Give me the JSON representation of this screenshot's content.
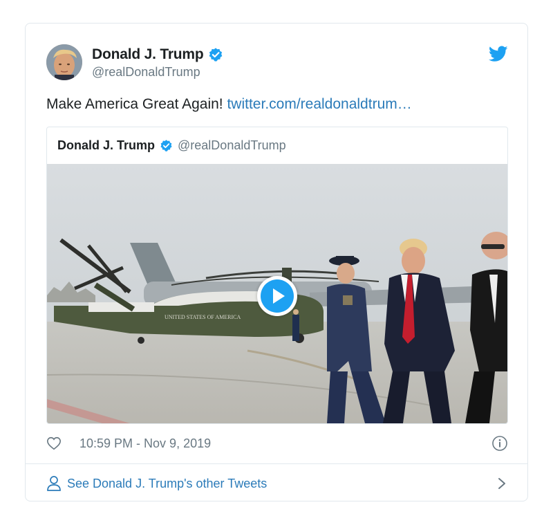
{
  "tweet": {
    "author_name": "Donald J. Trump",
    "author_handle": "@realDonaldTrump",
    "text": "Make America Great Again! ",
    "link_text": "twitter.com/realdonaldtrum…",
    "timestamp": "10:59 PM - Nov 9, 2019"
  },
  "quoted_tweet": {
    "author_name": "Donald J. Trump",
    "author_handle": "@realDonaldTrump",
    "helicopter_text": "UNITED STATES OF AMERICA"
  },
  "footer": {
    "see_more_label": "See Donald J. Trump's other Tweets"
  },
  "colors": {
    "link_blue": "#2b7bb9",
    "verified_blue": "#1da1f2",
    "muted_gray": "#697882",
    "border": "#e1e8ed"
  },
  "icons": {
    "verified": "verified-badge-icon",
    "twitter": "twitter-bird-icon",
    "play": "play-icon",
    "heart": "heart-icon",
    "info": "info-icon",
    "person": "person-icon",
    "chevron": "chevron-right-icon"
  }
}
